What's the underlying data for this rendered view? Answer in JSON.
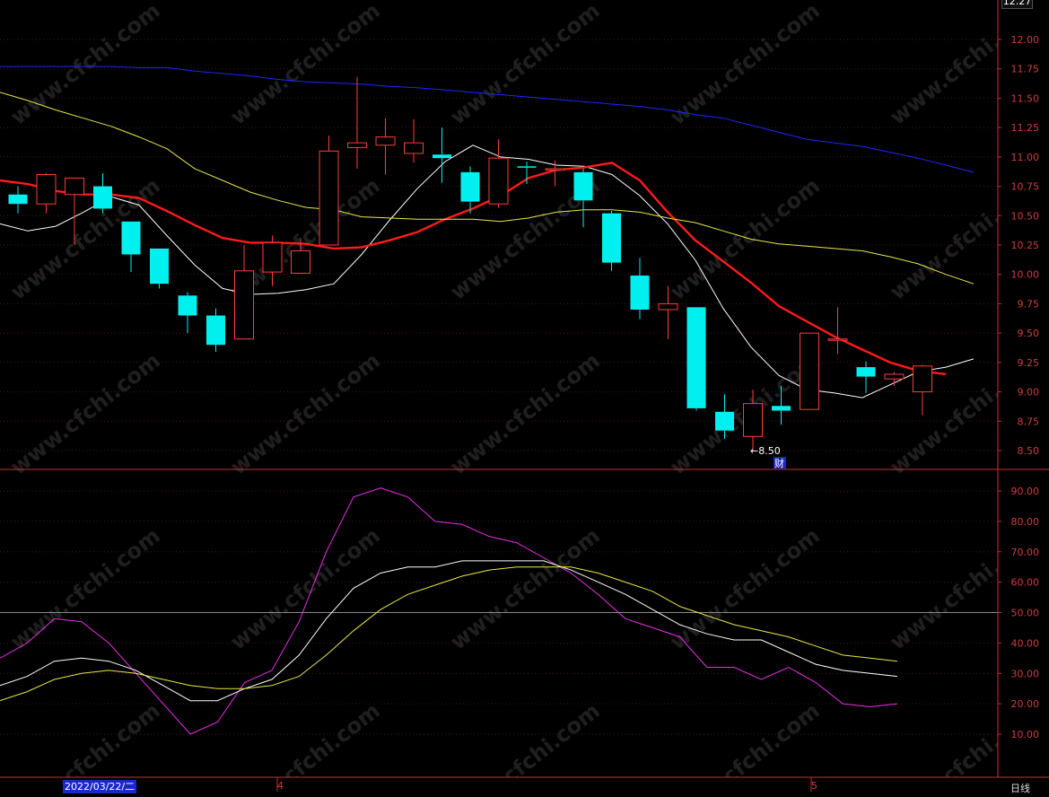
{
  "chart_data": [
    {
      "type": "candlestick",
      "y_axis_ticks": [
        "12.00",
        "11.75",
        "11.50",
        "11.25",
        "11.00",
        "10.75",
        "10.50",
        "10.25",
        "10.00",
        "9.75",
        "9.50",
        "9.25",
        "9.00",
        "8.75",
        "8.50"
      ],
      "ylim": [
        8.35,
        12.2
      ],
      "candles": [
        {
          "o": 10.68,
          "h": 10.75,
          "l": 10.52,
          "c": 10.6
        },
        {
          "o": 10.6,
          "h": 10.86,
          "l": 10.52,
          "c": 10.85
        },
        {
          "o": 10.68,
          "h": 10.82,
          "l": 10.25,
          "c": 10.82
        },
        {
          "o": 10.75,
          "h": 10.86,
          "l": 10.52,
          "c": 10.56
        },
        {
          "o": 10.45,
          "h": 10.45,
          "l": 10.02,
          "c": 10.17
        },
        {
          "o": 10.22,
          "h": 10.22,
          "l": 9.88,
          "c": 9.92
        },
        {
          "o": 9.82,
          "h": 9.85,
          "l": 9.5,
          "c": 9.65
        },
        {
          "o": 9.65,
          "h": 9.71,
          "l": 9.34,
          "c": 9.4
        },
        {
          "o": 9.45,
          "h": 10.25,
          "l": 9.45,
          "c": 10.03
        },
        {
          "o": 10.02,
          "h": 10.33,
          "l": 9.9,
          "c": 10.27
        },
        {
          "o": 10.01,
          "h": 10.3,
          "l": 10.01,
          "c": 10.2
        },
        {
          "o": 10.25,
          "h": 11.18,
          "l": 10.25,
          "c": 11.05
        },
        {
          "o": 11.08,
          "h": 11.68,
          "l": 10.9,
          "c": 11.12
        },
        {
          "o": 11.1,
          "h": 11.33,
          "l": 10.85,
          "c": 11.17
        },
        {
          "o": 11.03,
          "h": 11.32,
          "l": 10.95,
          "c": 11.12
        },
        {
          "o": 11.02,
          "h": 11.25,
          "l": 10.78,
          "c": 10.99
        },
        {
          "o": 10.87,
          "h": 10.92,
          "l": 10.52,
          "c": 10.62
        },
        {
          "o": 10.6,
          "h": 11.15,
          "l": 10.57,
          "c": 10.99
        },
        {
          "o": 10.92,
          "h": 10.96,
          "l": 10.77,
          "c": 10.91
        },
        {
          "o": 10.9,
          "h": 10.97,
          "l": 10.75,
          "c": 10.9
        },
        {
          "o": 10.87,
          "h": 10.9,
          "l": 10.4,
          "c": 10.63
        },
        {
          "o": 10.52,
          "h": 10.54,
          "l": 10.03,
          "c": 10.1
        },
        {
          "o": 9.99,
          "h": 10.14,
          "l": 9.62,
          "c": 9.7
        },
        {
          "o": 9.7,
          "h": 9.9,
          "l": 9.45,
          "c": 9.75
        },
        {
          "o": 9.72,
          "h": 9.72,
          "l": 8.84,
          "c": 8.86
        },
        {
          "o": 8.83,
          "h": 8.98,
          "l": 8.6,
          "c": 8.67
        },
        {
          "o": 8.62,
          "h": 9.02,
          "l": 8.5,
          "c": 8.9
        },
        {
          "o": 8.88,
          "h": 9.05,
          "l": 8.72,
          "c": 8.84
        },
        {
          "o": 8.85,
          "h": 9.5,
          "l": 8.85,
          "c": 9.5
        },
        {
          "o": 9.45,
          "h": 9.72,
          "l": 9.32,
          "c": 9.45
        },
        {
          "o": 9.21,
          "h": 9.26,
          "l": 8.99,
          "c": 9.13
        },
        {
          "o": 9.11,
          "h": 9.17,
          "l": 9.05,
          "c": 9.15
        },
        {
          "o": 9.0,
          "h": 9.23,
          "l": 8.8,
          "c": 9.22
        }
      ],
      "lines": [
        {
          "color": "#ffffff",
          "values": [
            10.43,
            10.37,
            10.41,
            10.53,
            10.66,
            10.59,
            10.33,
            10.08,
            9.88,
            9.83,
            9.84,
            9.87,
            9.92,
            10.17,
            10.46,
            10.73,
            10.96,
            11.1,
            11.0,
            10.98,
            10.93,
            10.92,
            10.85,
            10.67,
            10.43,
            10.12,
            9.71,
            9.38,
            9.14,
            9.02,
            8.99,
            8.95,
            9.06,
            9.17,
            9.21,
            9.28
          ]
        },
        {
          "color": "#ff1a1a",
          "values": [
            10.8,
            10.77,
            10.71,
            10.68,
            10.68,
            10.65,
            10.54,
            10.42,
            10.31,
            10.27,
            10.27,
            10.26,
            10.22,
            10.23,
            10.29,
            10.36,
            10.47,
            10.56,
            10.67,
            10.82,
            10.89,
            10.91,
            10.95,
            10.8,
            10.53,
            10.29,
            10.11,
            9.93,
            9.73,
            9.6,
            9.47,
            9.36,
            9.25,
            9.18,
            9.15
          ]
        },
        {
          "color": "#e8e84a",
          "values": [
            11.55,
            11.48,
            11.4,
            11.33,
            11.26,
            11.17,
            11.07,
            10.9,
            10.8,
            10.7,
            10.63,
            10.57,
            10.55,
            10.49,
            10.48,
            10.47,
            10.47,
            10.47,
            10.45,
            10.48,
            10.53,
            10.55,
            10.55,
            10.53,
            10.48,
            10.44,
            10.37,
            10.3,
            10.26,
            10.24,
            10.22,
            10.2,
            10.15,
            10.09,
            10.0,
            9.92
          ]
        },
        {
          "color": "#1a28ff",
          "values": [
            11.77,
            11.77,
            11.77,
            11.77,
            11.77,
            11.76,
            11.76,
            11.73,
            11.71,
            11.69,
            11.66,
            11.64,
            11.63,
            11.62,
            11.6,
            11.59,
            11.57,
            11.55,
            11.53,
            11.51,
            11.49,
            11.47,
            11.45,
            11.43,
            11.4,
            11.36,
            11.33,
            11.27,
            11.21,
            11.15,
            11.12,
            11.09,
            11.04,
            10.99,
            10.93,
            10.87
          ]
        }
      ],
      "annotations": {
        "low_marker": "←8.50",
        "flag": "财"
      },
      "watermark": "www.cfchi.com"
    },
    {
      "type": "line",
      "y_axis_ticks": [
        "90.00",
        "80.00",
        "70.00",
        "60.00",
        "50.00",
        "40.00",
        "30.00",
        "20.00",
        "10.00"
      ],
      "ylim": [
        0,
        100
      ],
      "reference_level": 50,
      "series": [
        {
          "color": "#e830e8",
          "values": [
            35,
            40,
            48,
            47,
            40,
            30,
            20,
            10,
            14,
            27,
            31,
            47,
            70,
            88,
            91,
            88,
            80,
            79,
            75,
            73,
            68,
            63,
            56,
            48,
            45,
            42,
            32,
            32,
            28,
            32,
            27,
            20,
            19,
            20
          ]
        },
        {
          "color": "#ffffff",
          "values": [
            26,
            29,
            34,
            35,
            34,
            31,
            26,
            21,
            21,
            25,
            28,
            36,
            48,
            58,
            63,
            65,
            65,
            67,
            67,
            67,
            67,
            64,
            60,
            56,
            51,
            46,
            43,
            41,
            41,
            37,
            33,
            31,
            30,
            29
          ]
        },
        {
          "color": "#e8e84a",
          "values": [
            21,
            24,
            28,
            30,
            31,
            30,
            28,
            26,
            25,
            25,
            26,
            29,
            36,
            44,
            51,
            56,
            59,
            62,
            64,
            65,
            65,
            65,
            63,
            60,
            57,
            52,
            49,
            46,
            44,
            42,
            39,
            36,
            35,
            34
          ]
        }
      ]
    }
  ],
  "axis": {
    "top_price": "12.27",
    "date": "2022/03/22/二",
    "month_4": "4",
    "month_5": "5",
    "timeframe": "日线"
  }
}
